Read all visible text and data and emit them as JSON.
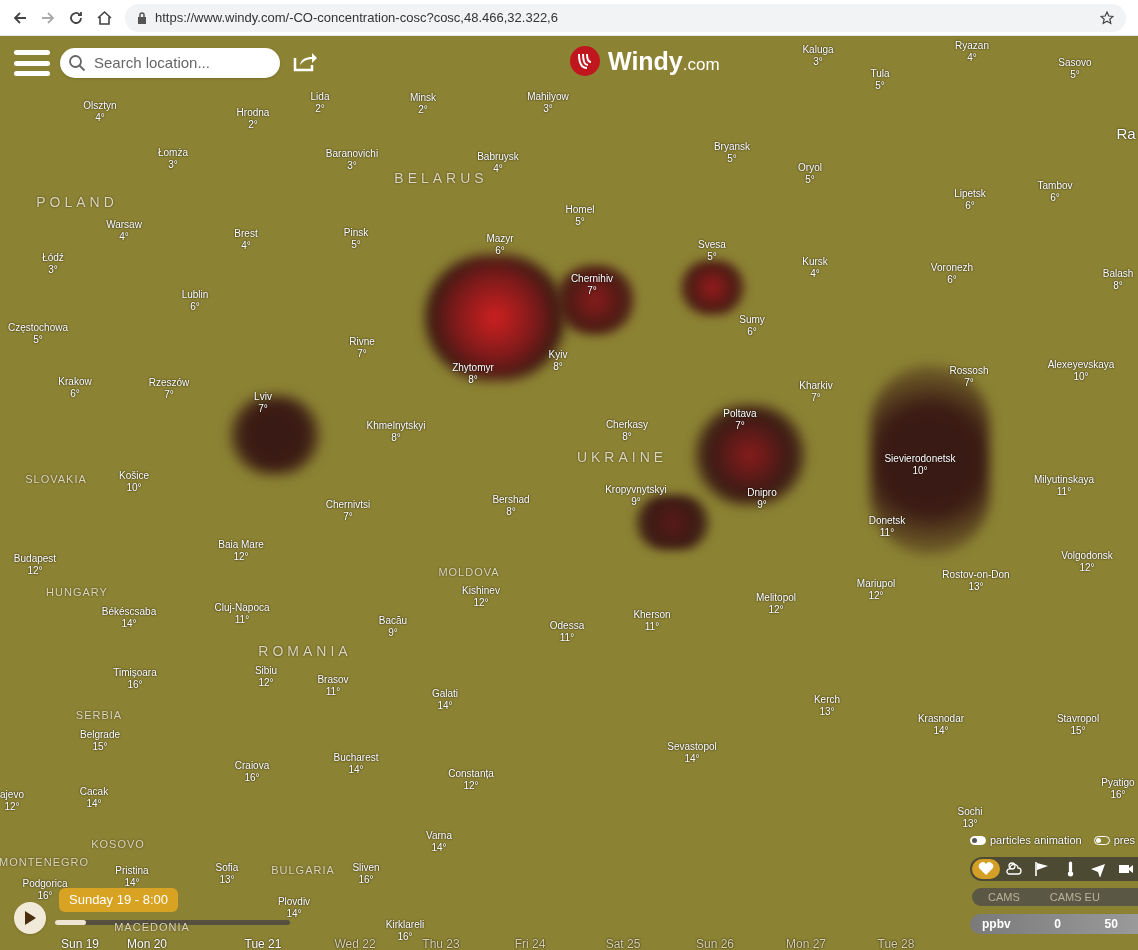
{
  "browser": {
    "url": "https://www.windy.com/-CO-concentration-cosc?cosc,48.466,32.322,6",
    "forward_disabled": true
  },
  "search": {
    "placeholder": "Search location..."
  },
  "logo": {
    "name": "Windy",
    "suffix": ".com"
  },
  "countries": [
    "POLAND",
    "BELARUS",
    "UKRAINE",
    "SLOVAKIA",
    "HUNGARY",
    "MOLDOVA",
    "ROMANIA",
    "SERBIA",
    "KOSOVO",
    "MONTENEGRO",
    "BULGARIA",
    "MACEDONIA"
  ],
  "cities": [
    {
      "name": "Olsztyn",
      "temp": "4°"
    },
    {
      "name": "Łomża",
      "temp": "3°"
    },
    {
      "name": "Warsaw",
      "temp": "4°"
    },
    {
      "name": "Łódź",
      "temp": "3°"
    },
    {
      "name": "Lublin",
      "temp": "6°"
    },
    {
      "name": "Częstochowa",
      "temp": "5°"
    },
    {
      "name": "Krakow",
      "temp": "6°"
    },
    {
      "name": "Rzeszów",
      "temp": "7°"
    },
    {
      "name": "Hrodna",
      "temp": "2°"
    },
    {
      "name": "Lida",
      "temp": "2°"
    },
    {
      "name": "Minsk",
      "temp": "2°"
    },
    {
      "name": "Mahilyow",
      "temp": "3°"
    },
    {
      "name": "Baranovichi",
      "temp": "3°"
    },
    {
      "name": "Babruysk",
      "temp": "4°"
    },
    {
      "name": "Brest",
      "temp": "4°"
    },
    {
      "name": "Pinsk",
      "temp": "5°"
    },
    {
      "name": "Mazyr",
      "temp": "6°"
    },
    {
      "name": "Homel",
      "temp": "5°"
    },
    {
      "name": "Chernihiv",
      "temp": "7°"
    },
    {
      "name": "Svesa",
      "temp": "5°"
    },
    {
      "name": "Kaluga",
      "temp": "3°"
    },
    {
      "name": "Tula",
      "temp": "5°"
    },
    {
      "name": "Ryazan",
      "temp": "4°"
    },
    {
      "name": "Sasovo",
      "temp": "5°"
    },
    {
      "name": "Bryansk",
      "temp": "5°"
    },
    {
      "name": "Oryol",
      "temp": "5°"
    },
    {
      "name": "Lipetsk",
      "temp": "6°"
    },
    {
      "name": "Tambov",
      "temp": "6°"
    },
    {
      "name": "Kursk",
      "temp": "4°"
    },
    {
      "name": "Voronezh",
      "temp": "6°"
    },
    {
      "name": "Sumy",
      "temp": "6°"
    },
    {
      "name": "Rivne",
      "temp": "7°"
    },
    {
      "name": "Zhytomyr",
      "temp": "8°"
    },
    {
      "name": "Kyiv",
      "temp": "8°"
    },
    {
      "name": "Lviv",
      "temp": "7°"
    },
    {
      "name": "Khmelnytskyi",
      "temp": "8°"
    },
    {
      "name": "Kharkiv",
      "temp": "7°"
    },
    {
      "name": "Poltava",
      "temp": "7°"
    },
    {
      "name": "Cherkasy",
      "temp": "8°"
    },
    {
      "name": "Rossosh",
      "temp": "7°"
    },
    {
      "name": "Alexeyevskaya",
      "temp": "10°"
    },
    {
      "name": "Sievierodonetsk",
      "temp": "10°"
    },
    {
      "name": "Milyutinskaya",
      "temp": "11°"
    },
    {
      "name": "Kropyvnytskyi",
      "temp": "9°"
    },
    {
      "name": "Dnipro",
      "temp": "9°"
    },
    {
      "name": "Donetsk",
      "temp": "11°"
    },
    {
      "name": "Bershad",
      "temp": "8°"
    },
    {
      "name": "Košice",
      "temp": "10°"
    },
    {
      "name": "Chernivtsi",
      "temp": "7°"
    },
    {
      "name": "Budapest",
      "temp": "12°"
    },
    {
      "name": "Baia Mare",
      "temp": "12°"
    },
    {
      "name": "Kishinev",
      "temp": "12°"
    },
    {
      "name": "Békéscsaba",
      "temp": "14°"
    },
    {
      "name": "Cluj-Napoca",
      "temp": "11°"
    },
    {
      "name": "Bacău",
      "temp": "9°"
    },
    {
      "name": "Odessa",
      "temp": "11°"
    },
    {
      "name": "Kherson",
      "temp": "11°"
    },
    {
      "name": "Melitopol",
      "temp": "12°"
    },
    {
      "name": "Mariupol",
      "temp": "12°"
    },
    {
      "name": "Rostov-on-Don",
      "temp": "13°"
    },
    {
      "name": "Volgodonsk",
      "temp": "12°"
    },
    {
      "name": "Timișoara",
      "temp": "16°"
    },
    {
      "name": "Sibiu",
      "temp": "12°"
    },
    {
      "name": "Brasov",
      "temp": "11°"
    },
    {
      "name": "Galati",
      "temp": "14°"
    },
    {
      "name": "Kerch",
      "temp": "13°"
    },
    {
      "name": "Krasnodar",
      "temp": "14°"
    },
    {
      "name": "Stavropol",
      "temp": "15°"
    },
    {
      "name": "Belgrade",
      "temp": "15°"
    },
    {
      "name": "Craiova",
      "temp": "16°"
    },
    {
      "name": "Bucharest",
      "temp": "14°"
    },
    {
      "name": "Constanța",
      "temp": "12°"
    },
    {
      "name": "Sevastopol",
      "temp": "14°"
    },
    {
      "name": "Cacak",
      "temp": "14°"
    },
    {
      "name": "Pyatigo",
      "temp": "16°"
    },
    {
      "name": "Sochi",
      "temp": "13°"
    },
    {
      "name": "Varna",
      "temp": "14°"
    },
    {
      "name": "Pristina",
      "temp": "14°"
    },
    {
      "name": "Sofia",
      "temp": "13°"
    },
    {
      "name": "Sliven",
      "temp": "16°"
    },
    {
      "name": "Podgorica",
      "temp": "16°"
    },
    {
      "name": "Plovdiv",
      "temp": "14°"
    },
    {
      "name": "Kirklareli",
      "temp": "16°"
    },
    {
      "name": "ajevo",
      "temp": "12°"
    },
    {
      "name": "Ra"
    },
    {
      "name": "Balash",
      "temp": "8°"
    }
  ],
  "toggles": [
    {
      "label": "particles animation",
      "on": true
    },
    {
      "label": "pres",
      "on": false
    }
  ],
  "layers": [
    {
      "kind": "favorites",
      "selected": true
    },
    {
      "kind": "weather",
      "selected": false
    },
    {
      "kind": "wind",
      "selected": false
    },
    {
      "kind": "temperature",
      "selected": false
    },
    {
      "kind": "aviation",
      "selected": false
    },
    {
      "kind": "webcam",
      "selected": false
    }
  ],
  "sources": [
    "CAMS",
    "CAMS EU"
  ],
  "legend": {
    "unit": "ppbv",
    "ticks": [
      "0",
      "50"
    ]
  },
  "timeline": {
    "time": "Sunday 19 - 8:00",
    "level": 0.13,
    "days": [
      "Sun 19",
      "Mon 20",
      "Tue 21",
      "Wed 22",
      "Thu 23",
      "Fri 24",
      "Sat 25",
      "Sun 26",
      "Mon 27",
      "Tue 28"
    ]
  }
}
